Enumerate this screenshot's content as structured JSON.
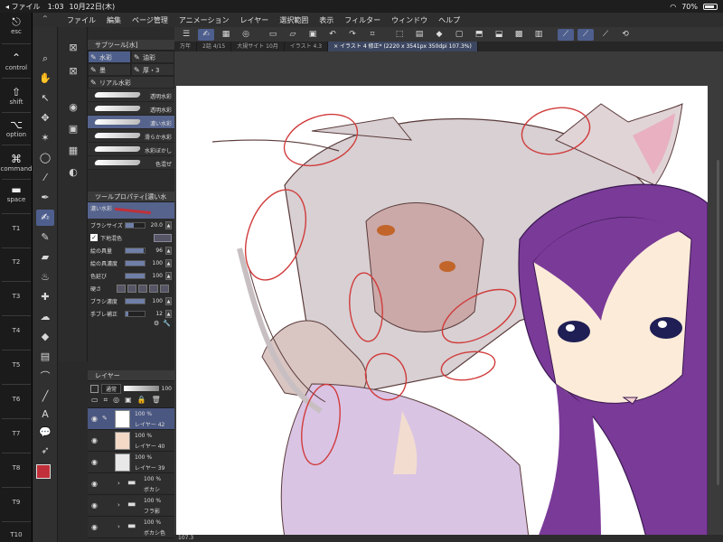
{
  "status": {
    "app": "ファイル",
    "time": "1:03",
    "date": "10月22日(木)",
    "battery": "70%"
  },
  "menu": [
    "ファイル",
    "編集",
    "ページ管理",
    "アニメーション",
    "レイヤー",
    "選択範囲",
    "表示",
    "フィルター",
    "ウィンドウ",
    "ヘルプ"
  ],
  "keys": [
    {
      "glyph": "⎋",
      "label": "esc"
    },
    {
      "glyph": "⌃",
      "label": "control"
    },
    {
      "glyph": "⇧",
      "label": "shift"
    },
    {
      "glyph": "⌥",
      "label": "option"
    },
    {
      "glyph": "⌘",
      "label": "command"
    },
    {
      "glyph": "▬",
      "label": "space"
    },
    {
      "glyph": "",
      "label": "T1"
    },
    {
      "glyph": "",
      "label": "T2"
    },
    {
      "glyph": "",
      "label": "T3"
    },
    {
      "glyph": "",
      "label": "T4"
    },
    {
      "glyph": "",
      "label": "T5"
    },
    {
      "glyph": "",
      "label": "T6"
    },
    {
      "glyph": "",
      "label": "T7"
    },
    {
      "glyph": "",
      "label": "T8"
    },
    {
      "glyph": "",
      "label": "T9"
    },
    {
      "glyph": "",
      "label": "T10"
    }
  ],
  "subtool": {
    "title": "サブツール[水]",
    "tabs": [
      "水彩",
      "油彩",
      "墨",
      "厚・3",
      "リアル水彩"
    ],
    "brushes": [
      "透明水彩",
      "透明水彩",
      "濃い水彩",
      "滑らか水彩",
      "水彩ぼかし",
      "色混ぜ"
    ]
  },
  "props": {
    "title": "ツールプロパティ[濃い水",
    "preview": "濃い水彩",
    "rows": [
      {
        "label": "ブラシサイズ",
        "value": "20.0",
        "fill": 0.45
      },
      {
        "label": "絵の具量",
        "value": "96",
        "fill": 0.96
      },
      {
        "label": "絵の具濃度",
        "value": "100",
        "fill": 1.0
      },
      {
        "label": "色延び",
        "value": "100",
        "fill": 1.0
      },
      {
        "label": "ブラシ濃度",
        "value": "100",
        "fill": 1.0
      },
      {
        "label": "手ブレ補正",
        "value": "12",
        "fill": 0.12
      }
    ],
    "check_label": "下地混色",
    "tip_label": "硬さ"
  },
  "layers": {
    "title": "レイヤー",
    "blend": "通常",
    "opacity": "100",
    "items": [
      {
        "pct": "100 %",
        "name": "レイヤー 42"
      },
      {
        "pct": "100 %",
        "name": "レイヤー 40"
      },
      {
        "pct": "100 %",
        "name": "レイヤー 39"
      },
      {
        "pct": "100 %",
        "name": "ボカシ"
      },
      {
        "pct": "100 %",
        "name": "フラ影"
      },
      {
        "pct": "100 %",
        "name": "ボカシ色"
      }
    ]
  },
  "doc_tabs": [
    "万年",
    "2話 4/15",
    "大規サイト 10月",
    "イラスト 4.3",
    "× イラスト 4 修正* (2220 x 3541px 350dpi 107.3%)"
  ],
  "zoom": "107.3"
}
